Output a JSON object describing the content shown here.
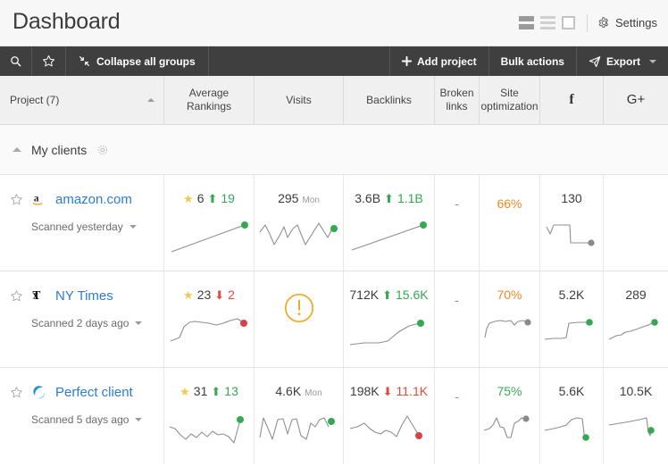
{
  "header": {
    "title": "Dashboard",
    "view_modes": [
      {
        "name": "view-mode-compact",
        "selected": true
      },
      {
        "name": "view-mode-rows",
        "selected": false
      },
      {
        "name": "view-mode-cards",
        "selected": false
      }
    ],
    "settings_label": "Settings",
    "gear_icon": "gear-icon"
  },
  "toolbar": {
    "search_icon": "search-icon",
    "favorite_icon": "star-icon",
    "collapse_icon": "collapse-icon",
    "collapse_label": "Collapse all groups",
    "add_project_label": "Add project",
    "add_project_icon": "plus-icon",
    "bulk_actions_label": "Bulk actions",
    "export_label": "Export",
    "export_icon": "paper-plane-icon",
    "export_caret_icon": "caret-down-icon"
  },
  "columns": [
    {
      "label": "Project (7)",
      "name": "column-project"
    },
    {
      "label": "Average Rankings",
      "name": "column-average-rankings"
    },
    {
      "label": "Visits",
      "name": "column-visits"
    },
    {
      "label": "Backlinks",
      "name": "column-backlinks"
    },
    {
      "label": "Broken links",
      "name": "column-broken-links"
    },
    {
      "label": "Site optimization",
      "name": "column-site-optimization"
    },
    {
      "label": "f",
      "name": "column-facebook"
    },
    {
      "label": "G+",
      "name": "column-google-plus"
    }
  ],
  "group": {
    "name": "My clients",
    "collapse_icon": "chevron-up-icon",
    "settings_icon": "gear-icon"
  },
  "rows": [
    {
      "name": "amazon.com",
      "icon": "amazon-icon",
      "scanned": "Scanned yesterday",
      "favorite": false,
      "average_rankings": {
        "starred": true,
        "value": "6",
        "delta": "19",
        "direction": "up"
      },
      "visits": {
        "value": "295",
        "unit": "Mon"
      },
      "backlinks": {
        "value": "3.6B",
        "delta": "1.1B",
        "direction": "up"
      },
      "broken_links": "-",
      "site_optimization": {
        "value": "66%",
        "color": "#f08a24"
      },
      "facebook": "130",
      "google_plus": ""
    },
    {
      "name": "NY Times",
      "icon": "nytimes-icon",
      "scanned": "Scanned 2 days ago",
      "favorite": false,
      "average_rankings": {
        "starred": true,
        "value": "23",
        "delta": "2",
        "direction": "down"
      },
      "visits": {
        "value": "",
        "unit": "",
        "alert": true
      },
      "backlinks": {
        "value": "712K",
        "delta": "15.6K",
        "direction": "up"
      },
      "broken_links": "-",
      "site_optimization": {
        "value": "70%",
        "color": "#f08a24"
      },
      "facebook": "5.2K",
      "google_plus": "289"
    },
    {
      "name": "Perfect client",
      "icon": "perfect-client-icon",
      "scanned": "Scanned 5 days ago",
      "favorite": false,
      "average_rankings": {
        "starred": true,
        "value": "31",
        "delta": "13",
        "direction": "up"
      },
      "visits": {
        "value": "4.6K",
        "unit": "Mon"
      },
      "backlinks": {
        "value": "198K",
        "delta": "11.1K",
        "direction": "down"
      },
      "broken_links": "-",
      "site_optimization": {
        "value": "75%",
        "color": "#35a853"
      },
      "facebook": "5.6K",
      "google_plus": "10.5K"
    }
  ],
  "colors": {
    "link": "#2b7cd3",
    "up": "#35a853",
    "down": "#e24b3b",
    "warn": "#f08a24",
    "toolbar_bg": "#3f3f3f"
  }
}
